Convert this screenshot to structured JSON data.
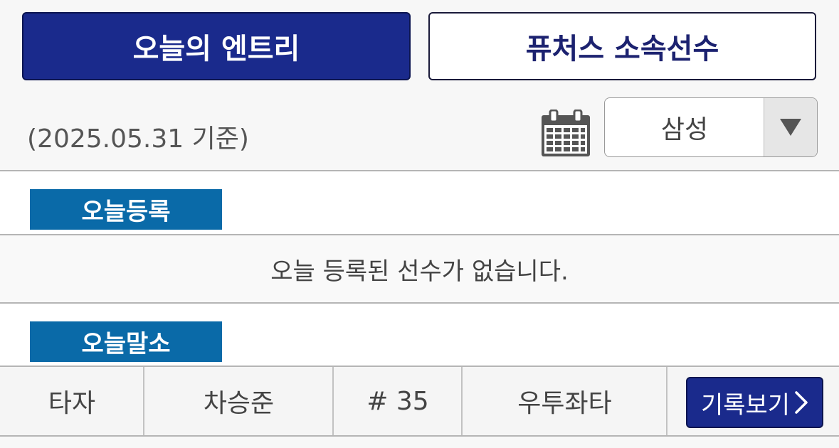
{
  "tabs": {
    "active_label": "오늘의 엔트리",
    "inactive_label": "퓨처스 소속선수"
  },
  "filter": {
    "date_text": "(2025.05.31 기준)",
    "calendar_icon": "calendar-icon",
    "team_selected": "삼성"
  },
  "sections": {
    "registered": {
      "label": "오늘등록",
      "empty_message": "오늘 등록된 선수가 없습니다."
    },
    "deregistered": {
      "label": "오늘말소",
      "rows": [
        {
          "position": "타자",
          "name": "차승준",
          "number": "# 35",
          "bats_throws": "우투좌타",
          "button_label": "기록보기"
        }
      ]
    }
  },
  "colors": {
    "tab_active_bg": "#1a2a8c",
    "section_label_bg": "#0a6aa8",
    "record_button_bg": "#1a2a8c"
  }
}
